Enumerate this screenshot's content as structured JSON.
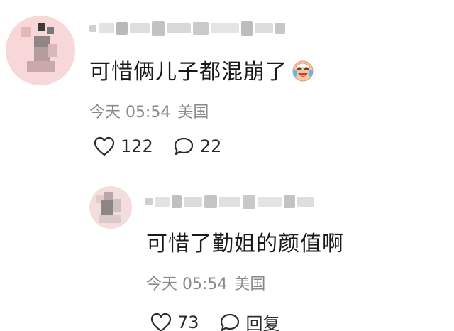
{
  "comments": [
    {
      "text": "可惜俩儿子都混崩了",
      "emoji": "crying-laughing-face",
      "time": "今天 05:54",
      "location": "美国",
      "likes": "122",
      "replies": "22"
    },
    {
      "text": "可惜了勤姐的颜值啊",
      "time": "今天 05:54",
      "location": "美国",
      "likes": "73",
      "reply_label": "回复"
    }
  ],
  "icons": {
    "like": "heart-outline-icon",
    "comment": "speech-bubble-icon"
  },
  "colors": {
    "meta_text": "#8a8a8a",
    "avatar_main_bg": "#f7d7d7"
  }
}
